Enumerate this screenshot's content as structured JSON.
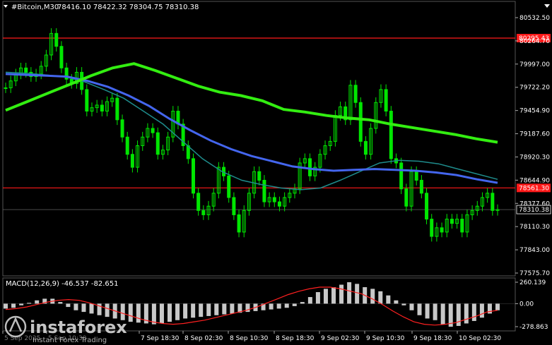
{
  "header": {
    "symbol_text": "#Bitcoin,M30",
    "ohlc_text": "78416.10 78422.32 78304.75 78310.38"
  },
  "macd": {
    "label": "MACD(12,26,9) -46.537 -82.651"
  },
  "watermark": {
    "brand": "instaforex",
    "tagline": "Instant Forex Trading"
  },
  "colors": {
    "background": "#000000",
    "candle": "#00e600",
    "ma_slow": "#33ee11",
    "ma_mid": "#4466ee",
    "ma_fast": "#1e8c8c",
    "hline": "#ff1a1a",
    "macd_hist": "#c8c8c8",
    "macd_signal": "#ff2020",
    "grid": "#555555"
  },
  "chart_data": {
    "type": "candlestick",
    "price_ticks": [
      "80532.50",
      "80264.70",
      "79997.00",
      "79722.20",
      "79454.90",
      "79187.60",
      "78920.30",
      "78644.90",
      "78377.60",
      "78110.30",
      "77843.00",
      "77575.70"
    ],
    "macd_ticks": [
      "260.139",
      "0.00",
      "-278.863"
    ],
    "time_labels": [
      "5 Sep 2025",
      "5 Sep 10:30",
      "7 Sep 18:30",
      "8 Sep 02:30",
      "8 Sep 10:30",
      "8 Sep 18:30",
      "9 Sep 02:30",
      "9 Sep 10:30",
      "9 Sep 18:30",
      "10 Sep 02:30"
    ],
    "hlines": [
      {
        "label": "80295.43",
        "value": 80295.43
      },
      {
        "label": "78561.30",
        "value": 78561.3
      }
    ],
    "current_price": {
      "label": "78310.38",
      "value": 78310.38
    },
    "close": [
      79720,
      79800,
      79880,
      79950,
      79900,
      79850,
      79880,
      79970,
      80100,
      80350,
      80200,
      79950,
      79820,
      79770,
      79900,
      79700,
      79450,
      79490,
      79520,
      79450,
      79560,
      79600,
      79350,
      79150,
      78950,
      78800,
      79050,
      79150,
      79250,
      79200,
      78950,
      79000,
      79150,
      79450,
      79300,
      79050,
      78900,
      78500,
      78300,
      78250,
      78350,
      78500,
      78800,
      78700,
      78450,
      78250,
      78050,
      78300,
      78500,
      78750,
      78650,
      78400,
      78450,
      78400,
      78350,
      78450,
      78500,
      78550,
      78850,
      78900,
      78700,
      78800,
      78950,
      79050,
      79100,
      79400,
      79500,
      79350,
      79750,
      79550,
      79100,
      78950,
      79250,
      79550,
      79700,
      79450,
      78900,
      78850,
      78550,
      78350,
      78750,
      78650,
      78500,
      78200,
      78000,
      78100,
      78050,
      78200,
      78150,
      78200,
      78050,
      78250,
      78300,
      78350,
      78450,
      78500,
      78300,
      78310.38
    ],
    "ma_slow": [
      79460,
      79560,
      79660,
      79760,
      79860,
      79950,
      80000,
      79920,
      79830,
      79740,
      79670,
      79630,
      79570,
      79470,
      79440,
      79400,
      79370,
      79350,
      79300,
      79260,
      79220,
      79180,
      79130,
      79090
    ],
    "ma_mid": [
      79880,
      79870,
      79860,
      79850,
      79800,
      79730,
      79630,
      79510,
      79360,
      79230,
      79110,
      79010,
      78930,
      78870,
      78810,
      78780,
      78760,
      78770,
      78780,
      78770,
      78760,
      78740,
      78710,
      78660,
      78620
    ],
    "ma_fast": [
      79900,
      79890,
      79870,
      79850,
      79790,
      79700,
      79600,
      79450,
      79300,
      79100,
      78900,
      78750,
      78650,
      78600,
      78560,
      78540,
      78560,
      78650,
      78750,
      78850,
      78880,
      78870,
      78840,
      78780,
      78720,
      78660
    ],
    "macd_hist": [
      -60,
      -50,
      -20,
      10,
      40,
      60,
      60,
      20,
      -40,
      -80,
      -100,
      -120,
      -140,
      -160,
      -180,
      -200,
      -220,
      -230,
      -240,
      -250,
      -240,
      -220,
      -200,
      -180,
      -170,
      -160,
      -150,
      -140,
      -130,
      -120,
      -110,
      -100,
      -90,
      -80,
      -70,
      -60,
      -50,
      -30,
      20,
      80,
      140,
      180,
      200,
      230,
      260,
      240,
      200,
      180,
      150,
      100,
      40,
      -20,
      -80,
      -140,
      -180,
      -200,
      -250,
      -280,
      -270,
      -240,
      -210,
      -170,
      -120,
      -80
    ],
    "macd_signal": [
      -70,
      -60,
      -40,
      -10,
      20,
      40,
      50,
      40,
      10,
      -30,
      -70,
      -110,
      -150,
      -190,
      -220,
      -240,
      -250,
      -240,
      -220,
      -200,
      -170,
      -140,
      -110,
      -80,
      -40,
      10,
      60,
      110,
      150,
      180,
      200,
      200,
      180,
      150,
      120,
      60,
      -10,
      -90,
      -160,
      -220,
      -250,
      -260,
      -250,
      -230,
      -190,
      -150,
      -100,
      -80
    ],
    "price_range": [
      77575.7,
      80532.5
    ],
    "macd_range": [
      -278.863,
      260.139
    ]
  }
}
